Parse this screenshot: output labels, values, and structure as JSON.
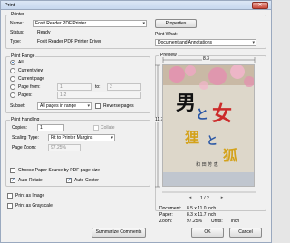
{
  "window": {
    "title": "Print"
  },
  "printer": {
    "group_title": "Printer",
    "name_label": "Name:",
    "name_value": "Foxit Reader PDF Printer",
    "properties_button": "Properties",
    "status_label": "Status:",
    "status_value": "Ready",
    "type_label": "Type:",
    "type_value": "Foxit Reader PDF Printer Driver"
  },
  "print_what": {
    "label": "Print What:",
    "value": "Document and Annotations"
  },
  "print_range": {
    "group_title": "Print Range",
    "all": "All",
    "current_view": "Current view",
    "current_page": "Current page",
    "page_from": "Page from:",
    "from_value": "1",
    "to_label": "to:",
    "to_value": "2",
    "pages_label": "Pages:",
    "pages_value": "1-2",
    "subset_label": "Subset:",
    "subset_value": "All pages in range",
    "reverse_pages": "Reverse pages"
  },
  "print_handling": {
    "group_title": "Print Handling",
    "copies_label": "Copies:",
    "copies_value": "1",
    "collate": "Collate",
    "scaling_label": "Scaling Type:",
    "scaling_value": "Fit to Printer Margins",
    "zoom_label": "Page Zoom:",
    "zoom_value": "97.25%",
    "choose_paper": "Choose Paper Source by PDF page size",
    "auto_rotate": "Auto-Rotate",
    "auto_center": "Auto-Center"
  },
  "options": {
    "print_as_image": "Print as Image",
    "print_as_grayscale": "Print as Grayscale"
  },
  "preview": {
    "group_title": "Preview",
    "width_dim": "8.3",
    "height_dim": "11.7",
    "page_indicator": "1 / 2",
    "book_title_1": "男",
    "book_title_2": "と",
    "book_title_3": "女",
    "book_title_4": "狸",
    "book_title_5": "と",
    "book_title_6": "狐",
    "book_author": "和 田 芳 恵"
  },
  "doc_info": {
    "document_label": "Document:",
    "document_value": "8.5 x 11.0 inch",
    "paper_label": "Paper:",
    "paper_value": "8.3 x 11.7 inch",
    "zoom_label": "Zoom:",
    "zoom_value": "97.25%",
    "units_label": "Units:",
    "units_value": "inch"
  },
  "footer": {
    "summarize_button": "Summarize Comments",
    "ok_button": "OK",
    "cancel_button": "Cancel"
  },
  "colors": {
    "accent": "#1f5fb0",
    "book_cover": "#d9d3c5",
    "flower_pink": "#e58fb0",
    "book_red": "#cc2b2b",
    "book_blue": "#2a57a5",
    "book_yellow": "#d4a21a"
  }
}
